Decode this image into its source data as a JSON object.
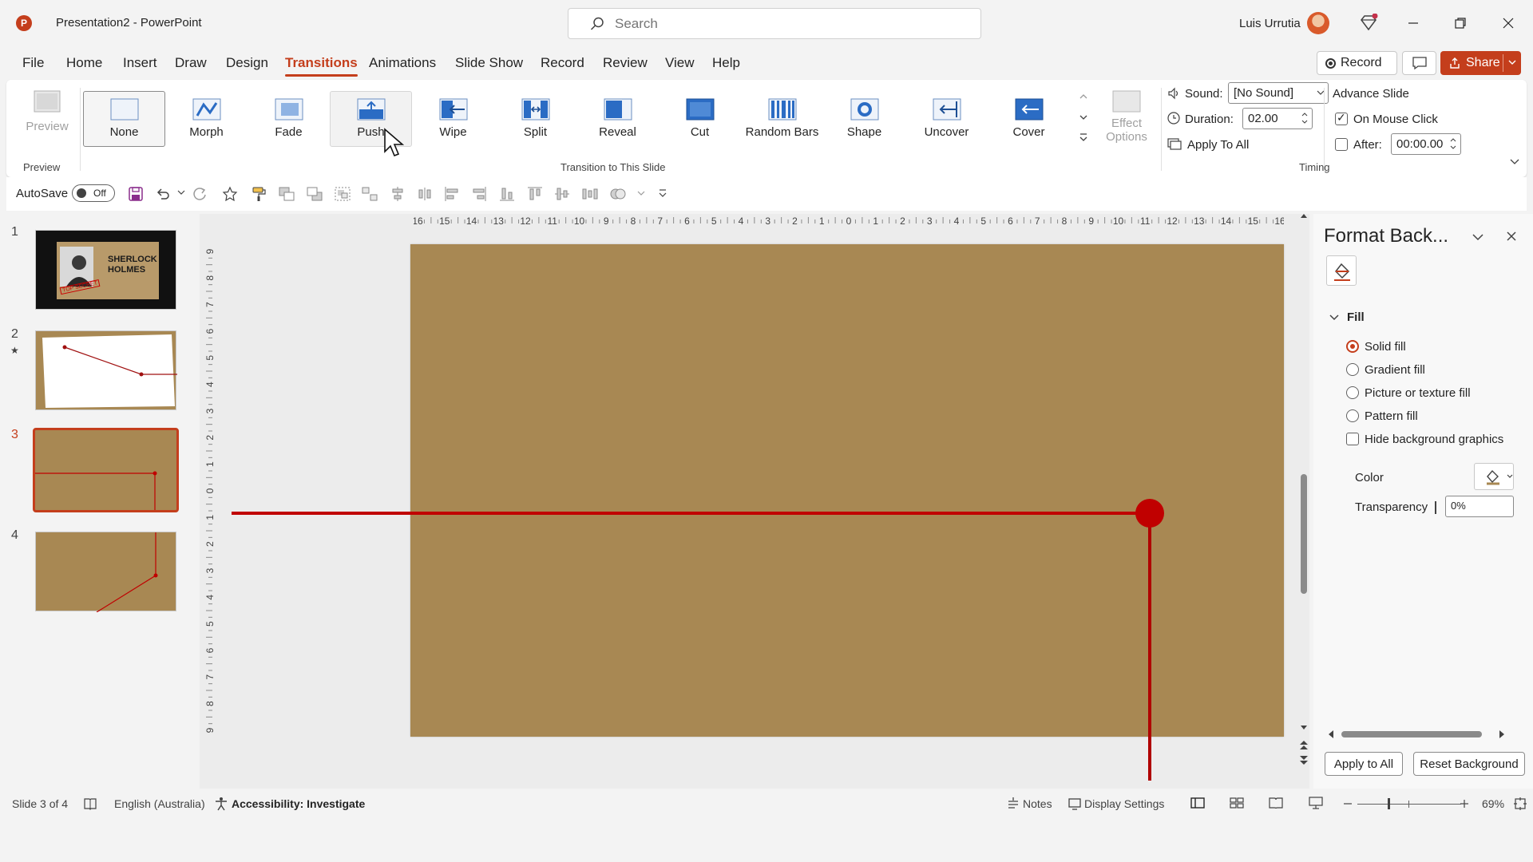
{
  "app": {
    "logo_letter": "P",
    "title": "Presentation2  -  PowerPoint",
    "user_name": "Luis Urrutia"
  },
  "search": {
    "placeholder": "Search"
  },
  "menu": {
    "tabs": [
      "File",
      "Home",
      "Insert",
      "Draw",
      "Design",
      "Transitions",
      "Animations",
      "Slide Show",
      "Record",
      "Review",
      "View",
      "Help"
    ],
    "active": "Transitions",
    "record_label": "Record",
    "share_label": "Share"
  },
  "ribbon": {
    "preview_label": "Preview",
    "preview_group": "Preview",
    "transitions_group": "Transition to This Slide",
    "transitions": [
      "None",
      "Morph",
      "Fade",
      "Push",
      "Wipe",
      "Split",
      "Reveal",
      "Cut",
      "Random Bars",
      "Shape",
      "Uncover",
      "Cover"
    ],
    "selected_transition": "None",
    "hovered_transition": "Push",
    "effect_options_line1": "Effect",
    "effect_options_line2": "Options",
    "timing": {
      "sound_label": "Sound:",
      "sound_value": "[No Sound]",
      "duration_label": "Duration:",
      "duration_value": "02.00",
      "apply_all": "Apply To All",
      "advance_slide": "Advance Slide",
      "on_mouse_click": "On Mouse Click",
      "on_mouse_click_checked": true,
      "after_label": "After:",
      "after_checked": false,
      "after_value": "00:00.00",
      "group_label": "Timing"
    }
  },
  "qat": {
    "autosave_label": "AutoSave",
    "autosave_state": "Off"
  },
  "slides": {
    "numbers": [
      "1",
      "2",
      "3",
      "4"
    ],
    "selected": 3,
    "slide1_title_1": "SHERLOCK",
    "slide1_title_2": "HOLMES",
    "slide1_stamp": "TOP SECRET"
  },
  "ruler": {
    "h_ticks": [
      "16",
      "15",
      "14",
      "13",
      "12",
      "11",
      "10",
      "9",
      "8",
      "7",
      "6",
      "5",
      "4",
      "3",
      "2",
      "1",
      "0",
      "1",
      "2",
      "3",
      "4",
      "5",
      "6",
      "7",
      "8",
      "9",
      "10",
      "11",
      "12",
      "13",
      "14",
      "15",
      "16"
    ],
    "v_ticks": [
      "9",
      "8",
      "7",
      "6",
      "5",
      "4",
      "3",
      "2",
      "1",
      "0",
      "1",
      "2",
      "3",
      "4",
      "5",
      "6",
      "7",
      "8",
      "9"
    ]
  },
  "slide_colors": {
    "background": "#a88853",
    "line": "#c00000"
  },
  "pane": {
    "title": "Format Back...",
    "section": "Fill",
    "options": [
      "Solid fill",
      "Gradient fill",
      "Picture or texture fill",
      "Pattern fill"
    ],
    "selected_option": "Solid fill",
    "hide_bg": "Hide background graphics",
    "color_label": "Color",
    "transparency_label": "Transparency",
    "transparency_value": "0%",
    "apply_all": "Apply to All",
    "reset": "Reset Background"
  },
  "status": {
    "slide_info": "Slide 3 of 4",
    "language": "English (Australia)",
    "accessibility": "Accessibility: Investigate",
    "notes": "Notes",
    "display_settings": "Display Settings",
    "zoom": "69%"
  },
  "colors": {
    "accent": "#c43e1c",
    "slide": "#a88853",
    "red_line": "#c00000"
  }
}
